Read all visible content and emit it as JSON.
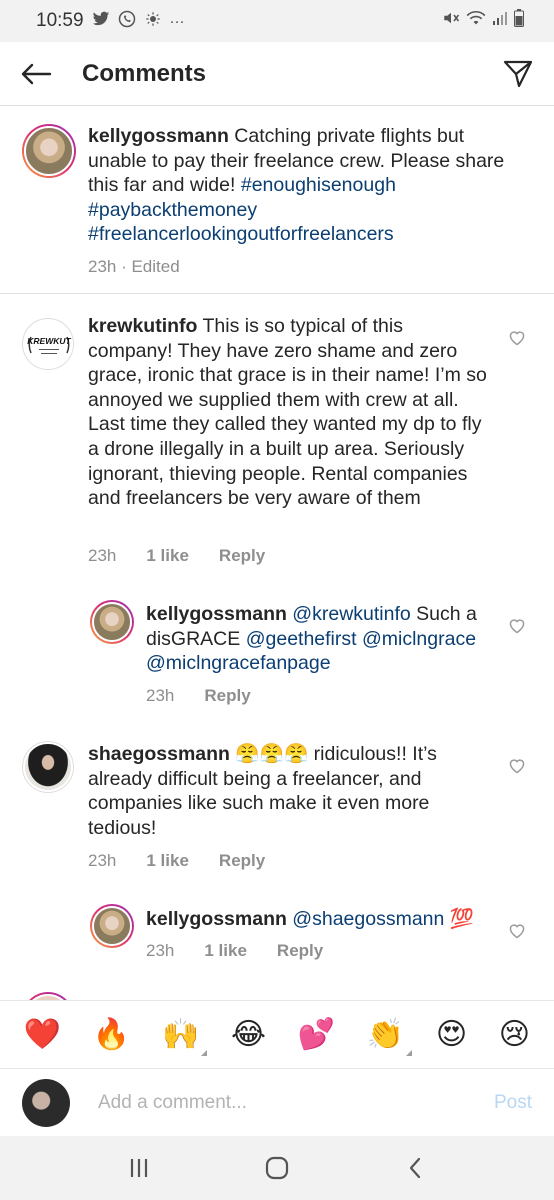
{
  "status_bar": {
    "time": "10:59",
    "icons": [
      "twitter-icon",
      "whatsapp-icon",
      "weather-icon",
      "more-dots-icon"
    ],
    "right_icons": [
      "mute-icon",
      "wifi-icon",
      "signal-icon",
      "battery-icon"
    ],
    "dots": "···"
  },
  "header": {
    "title": "Comments"
  },
  "caption": {
    "username": "kellygossmann",
    "text": " Catching private flights but unable to pay their freelance crew. Please share this far and wide! ",
    "tags": "#enoughisenough #paybackthemoney #freelancerlookingoutforfreelancers",
    "meta": "23h · Edited"
  },
  "comments": [
    {
      "username": "krewkutinfo",
      "text": " This is so typical of this company! They have zero shame and zero grace, ironic that grace is in their name! I’m so annoyed we supplied them with crew at all. Last time they called they wanted my dp to fly a drone illegally in a built up area. Seriously ignorant, thieving people. Rental companies and freelancers be very aware of them",
      "time": "23h",
      "likes": "1 like",
      "reply": "Reply",
      "logo_text": "KREWKUT"
    },
    {
      "username": "kellygossmann",
      "mention": " @krewkutinfo",
      "text": " Such a disGRACE ",
      "mentions2": "@geethefirst @miclngrace @miclngracefanpage",
      "time": "23h",
      "reply": "Reply"
    },
    {
      "username": "shaegossmann",
      "emojis": " 😤😤😤",
      "text": " ridiculous!! It’s already difficult being a freelancer, and companies like such make it even more tedious!",
      "time": "23h",
      "likes": "1 like",
      "reply": "Reply"
    },
    {
      "username": "kellygossmann",
      "mention": " @shaegossmann",
      "emoji": " 💯",
      "time": "23h",
      "likes": "1 like",
      "reply": "Reply"
    }
  ],
  "emoji_bar": [
    "❤️",
    "🔥",
    "🙌",
    "😂",
    "💕",
    "👏",
    "😍",
    "😢"
  ],
  "add_comment": {
    "placeholder": "Add a comment...",
    "post": "Post"
  }
}
